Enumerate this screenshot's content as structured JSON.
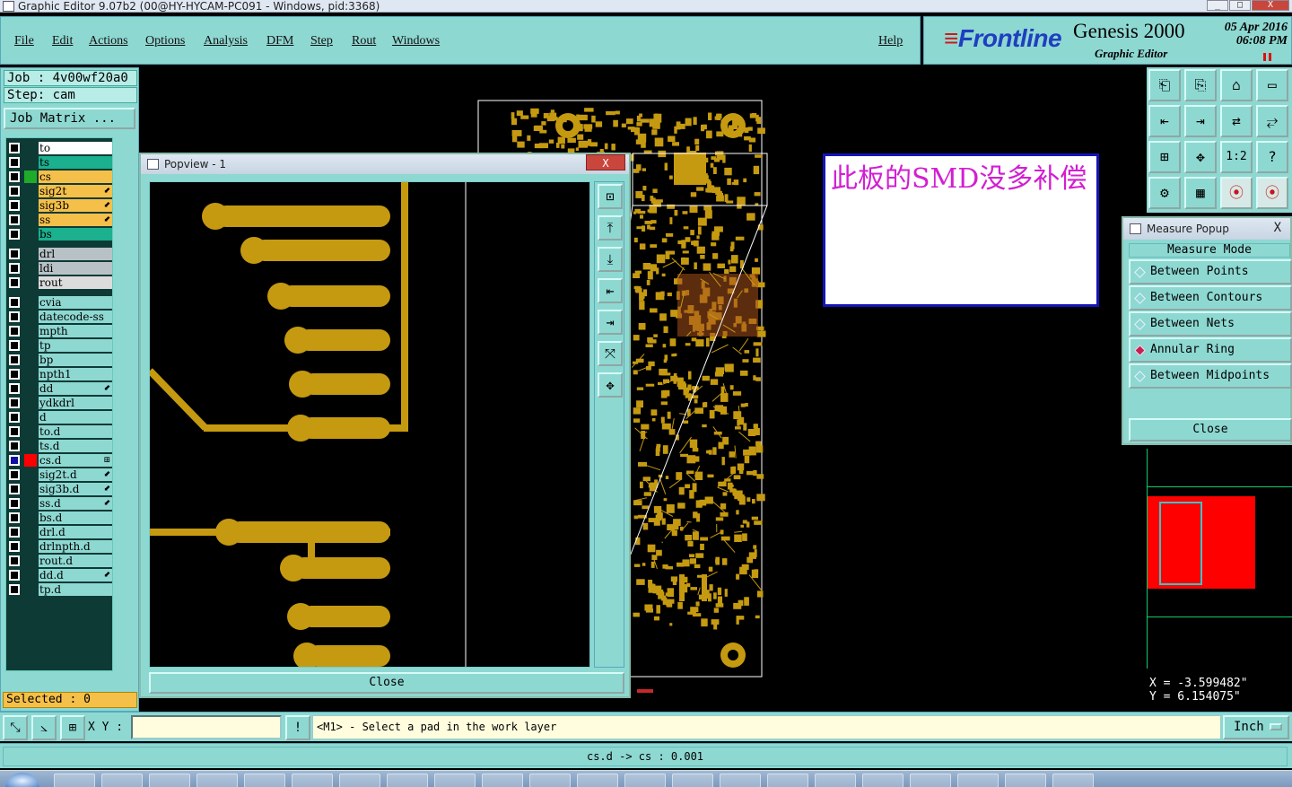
{
  "window": {
    "title": "Graphic Editor 9.07b2 (00@HY-HYCAM-PC091 - Windows, pid:3368)",
    "controls": [
      "_",
      "□",
      "X"
    ]
  },
  "menu": {
    "items": [
      "File",
      "Edit",
      "Actions",
      "Options",
      "Analysis",
      "DFM",
      "Step",
      "Rout",
      "Windows"
    ],
    "help": "Help"
  },
  "brand": {
    "logo": "Frontline",
    "product": "Genesis 2000",
    "subtitle": "Graphic Editor",
    "date": "05 Apr 2016",
    "time": "06:08 PM"
  },
  "job": {
    "job_label": "Job : 4v00wf20a0",
    "step_label": "Step: cam",
    "matrix_button": "Job Matrix ..."
  },
  "layers": [
    {
      "name": "to",
      "color": "#ffffff",
      "tag": "",
      "mark": ""
    },
    {
      "name": "ts",
      "color": "#1bb08e",
      "tag": "",
      "mark": ""
    },
    {
      "name": "cs",
      "color": "#f5c04a",
      "tag": "#1faa2a",
      "mark": ""
    },
    {
      "name": "sig2t",
      "color": "#f5c04a",
      "tag": "",
      "mark": "⬋"
    },
    {
      "name": "sig3b",
      "color": "#f5c04a",
      "tag": "",
      "mark": "⬋"
    },
    {
      "name": "ss",
      "color": "#f5c04a",
      "tag": "",
      "mark": "⬋"
    },
    {
      "name": "bs",
      "color": "#1bb08e",
      "tag": "",
      "mark": ""
    },
    {
      "name": "drl",
      "color": "#b8c2c6",
      "tag": "",
      "mark": ""
    },
    {
      "name": "ldi",
      "color": "#b8c2c6",
      "tag": "",
      "mark": ""
    },
    {
      "name": "rout",
      "color": "#dcdcdc",
      "tag": "",
      "mark": ""
    },
    {
      "name": "cvia",
      "color": "#8ed8d2",
      "tag": "",
      "mark": ""
    },
    {
      "name": "datecode-ss",
      "color": "#8ed8d2",
      "tag": "",
      "mark": ""
    },
    {
      "name": "mpth",
      "color": "#8ed8d2",
      "tag": "",
      "mark": ""
    },
    {
      "name": "tp",
      "color": "#8ed8d2",
      "tag": "",
      "mark": ""
    },
    {
      "name": "bp",
      "color": "#8ed8d2",
      "tag": "",
      "mark": ""
    },
    {
      "name": "npth1",
      "color": "#8ed8d2",
      "tag": "",
      "mark": ""
    },
    {
      "name": "dd",
      "color": "#8ed8d2",
      "tag": "",
      "mark": "⬋"
    },
    {
      "name": "ydkdrl",
      "color": "#8ed8d2",
      "tag": "",
      "mark": ""
    },
    {
      "name": "d",
      "color": "#8ed8d2",
      "tag": "",
      "mark": ""
    },
    {
      "name": "to.d",
      "color": "#8ed8d2",
      "tag": "",
      "mark": ""
    },
    {
      "name": "ts.d",
      "color": "#8ed8d2",
      "tag": "",
      "mark": ""
    },
    {
      "name": "cs.d",
      "color": "#8ed8d2",
      "tag": "#ff0000",
      "mark": "⊞",
      "active": true
    },
    {
      "name": "sig2t.d",
      "color": "#8ed8d2",
      "tag": "",
      "mark": "⬋"
    },
    {
      "name": "sig3b.d",
      "color": "#8ed8d2",
      "tag": "",
      "mark": "⬋"
    },
    {
      "name": "ss.d",
      "color": "#8ed8d2",
      "tag": "",
      "mark": "⬋"
    },
    {
      "name": "bs.d",
      "color": "#8ed8d2",
      "tag": "",
      "mark": ""
    },
    {
      "name": "drl.d",
      "color": "#8ed8d2",
      "tag": "",
      "mark": ""
    },
    {
      "name": "drlnpth.d",
      "color": "#8ed8d2",
      "tag": "",
      "mark": ""
    },
    {
      "name": "rout.d",
      "color": "#8ed8d2",
      "tag": "",
      "mark": ""
    },
    {
      "name": "dd.d",
      "color": "#8ed8d2",
      "tag": "",
      "mark": "⬋"
    },
    {
      "name": "tp.d",
      "color": "#8ed8d2",
      "tag": "",
      "mark": ""
    }
  ],
  "selected": "Selected : 0",
  "popview": {
    "title": "Popview - 1",
    "close_x": "X",
    "close_button": "Close"
  },
  "note": {
    "text": "此板的SMD没多补偿"
  },
  "measure": {
    "title": "Measure Popup",
    "close_x": "X",
    "header": "Measure Mode",
    "options": [
      {
        "label": "Between Points",
        "active": false
      },
      {
        "label": "Between Contours",
        "active": false
      },
      {
        "label": "Between Nets",
        "active": false
      },
      {
        "label": "Annular Ring",
        "active": true
      },
      {
        "label": "Between Midpoints",
        "active": false
      }
    ],
    "close_button": "Close"
  },
  "coords": {
    "x": "X  =  -3.599482\"",
    "y": "Y  =   6.154075\""
  },
  "command": {
    "xy_label": "X Y :",
    "xy_value": "",
    "prompt": "<M1> - Select a pad in the work layer",
    "units": "Inch"
  },
  "status": "cs.d -> cs : 0.001",
  "colors": {
    "panel": "#8ed8d2",
    "copper": "#c59a10",
    "accent_red": "#ff0000"
  },
  "icons": {
    "tool_grid": [
      "clipboard-up-icon",
      "clipboard-down-icon",
      "home-icon",
      "window-icon",
      "pan-left-icon",
      "pan-right-icon",
      "mirror-icon",
      "swap-icon",
      "fit-icon",
      "zoom-icon",
      "scale-1to2-icon",
      "help-icon",
      "settings-icon",
      "grid-icon",
      "layer-red-icon",
      "layer-red-alt-icon"
    ],
    "popview_tools": [
      "zoom-box-icon",
      "zoom-in-icon",
      "zoom-out-icon",
      "pan-left-icon",
      "pan-right-icon",
      "fit-icon",
      "center-icon"
    ],
    "command_tools": [
      "measure-icon",
      "snap-icon",
      "grid-snap-icon",
      "info-icon"
    ]
  }
}
